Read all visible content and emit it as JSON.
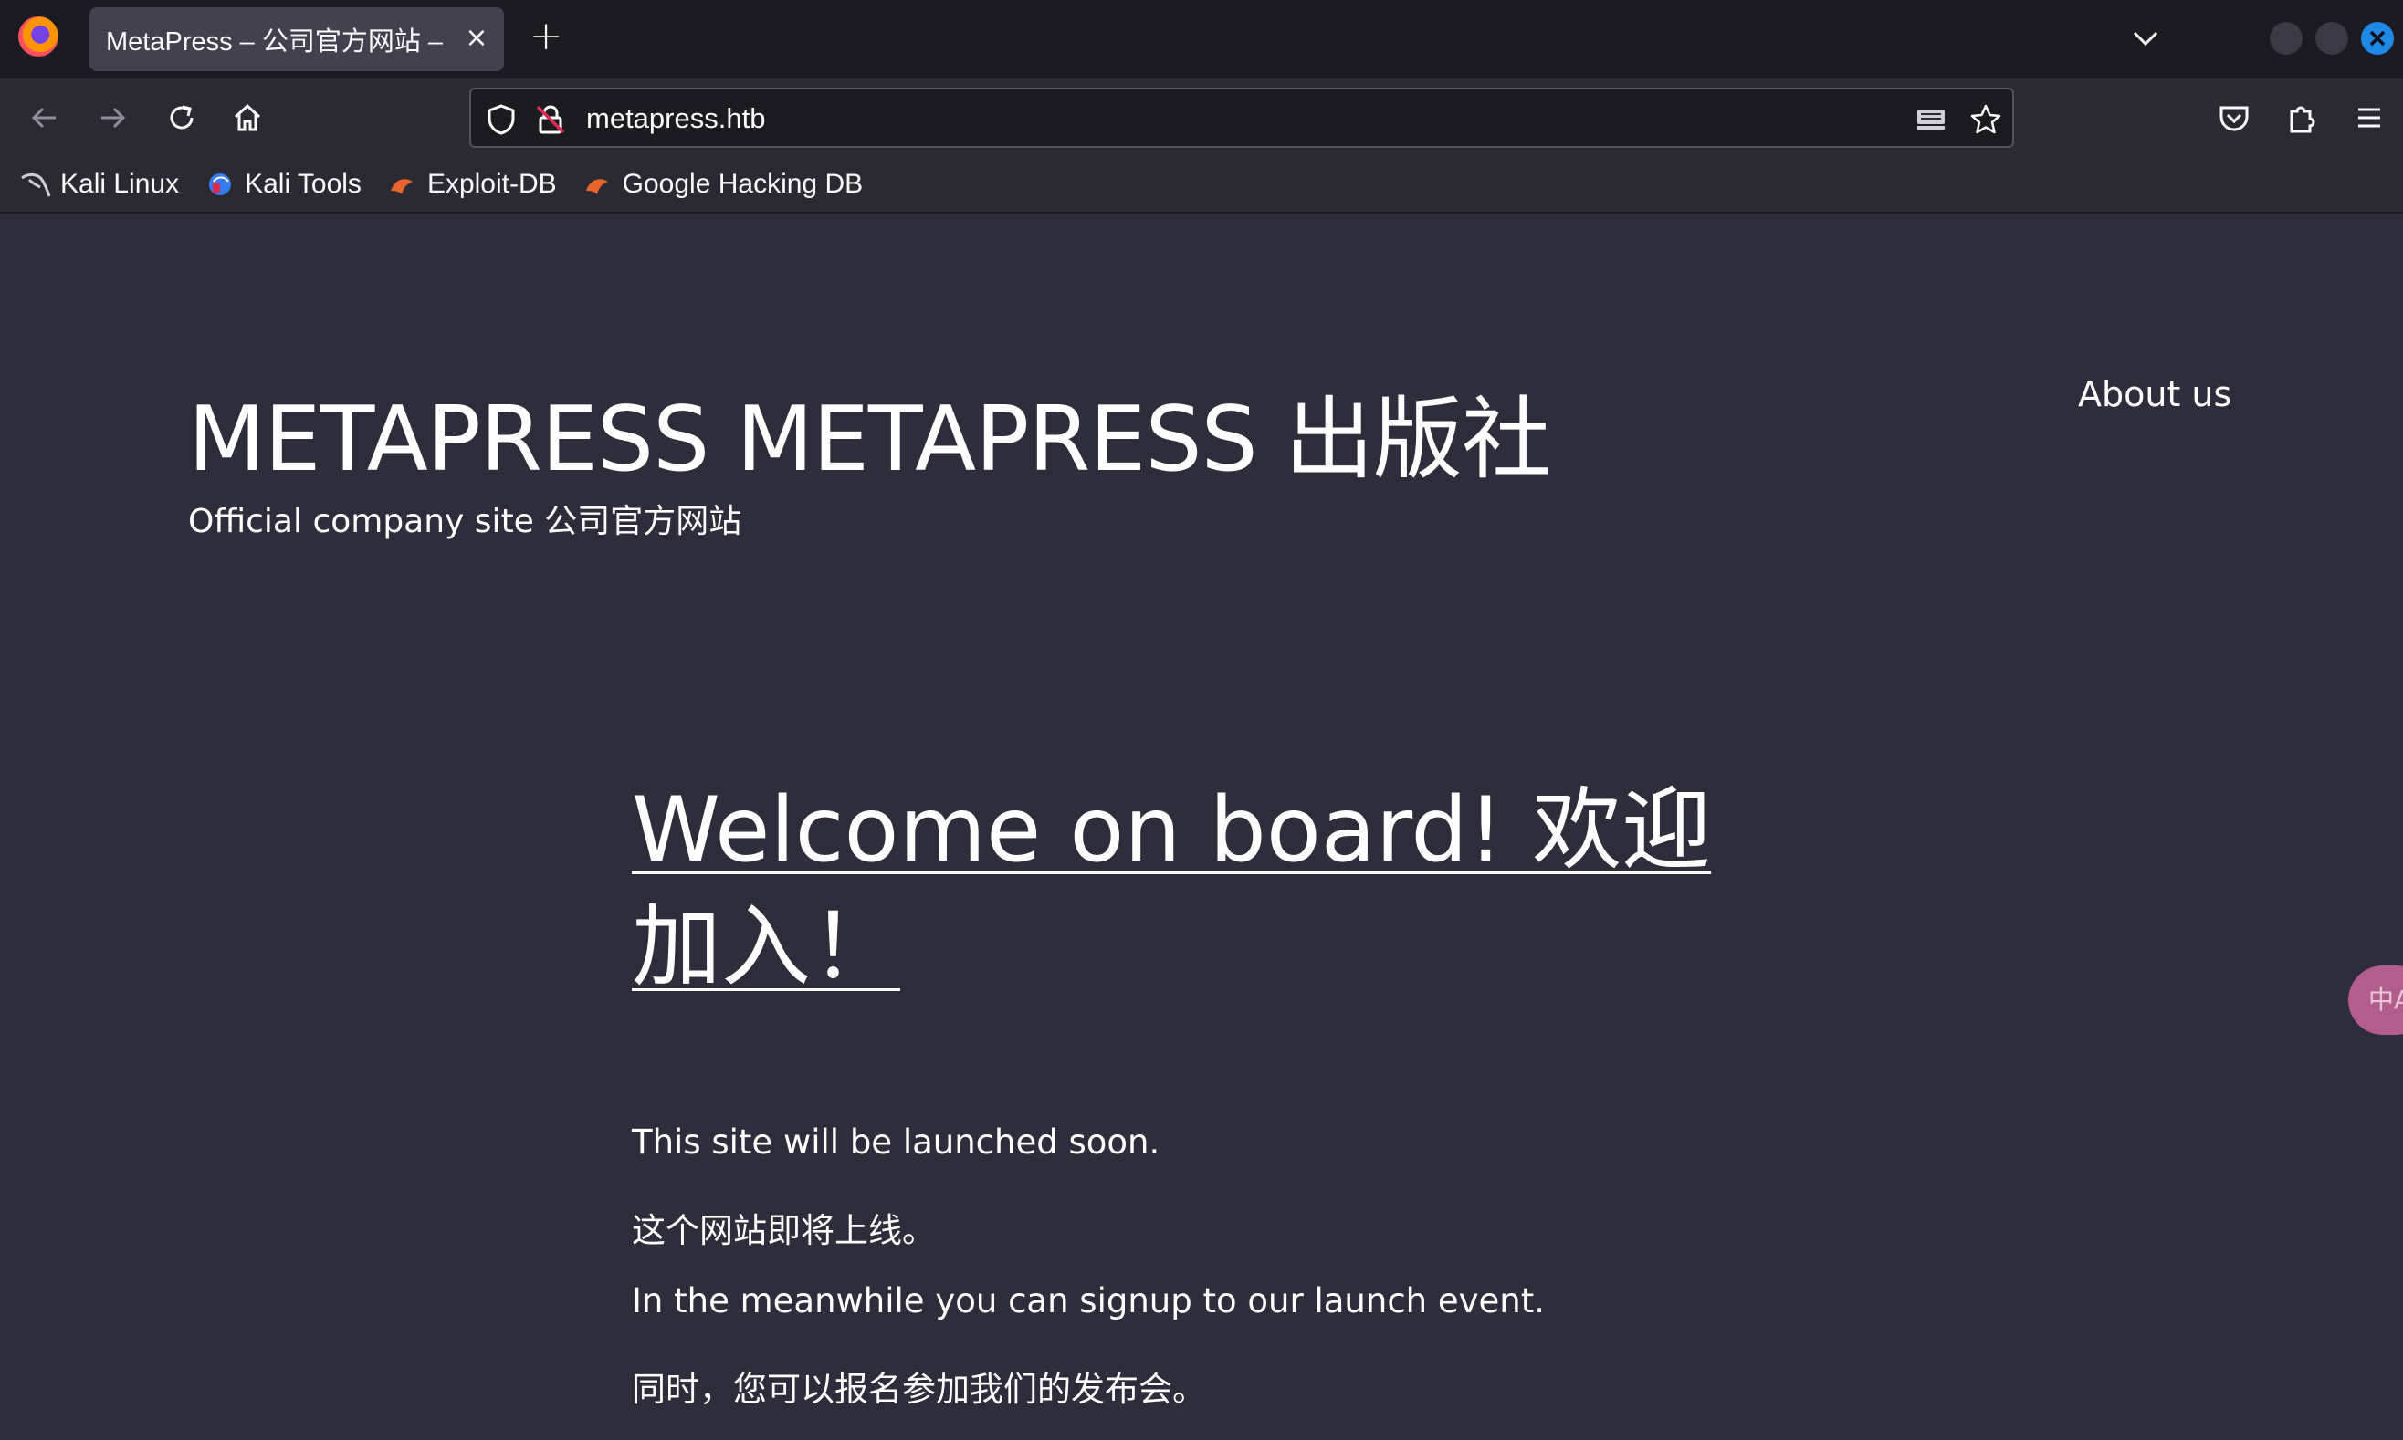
{
  "browser": {
    "tab": {
      "title": "MetaPress – 公司官方网站 – ",
      "close_label": "×"
    },
    "new_tab_label": "+",
    "url": "metapress.htb",
    "bookmarks": [
      {
        "label": "Kali Linux",
        "icon": "kali-dragon-icon"
      },
      {
        "label": "Kali Tools",
        "icon": "kali-tools-icon"
      },
      {
        "label": "Exploit-DB",
        "icon": "exploit-db-icon"
      },
      {
        "label": "Google Hacking DB",
        "icon": "exploit-db-icon"
      }
    ],
    "accent_color": "#1e88e5"
  },
  "site": {
    "title": "METAPRESS METAPRESS 出版社",
    "tagline": "Official company site  公司官方网站",
    "nav": {
      "about": "About us"
    }
  },
  "main": {
    "heading": "Welcome on board! 欢迎加入！",
    "paragraphs": [
      "This site will be launched soon.",
      "这个网站即将上线。",
      "In the meanwhile you can signup to our launch event.",
      "同时，您可以报名参加我们的发布会。"
    ]
  },
  "translate_widget": {
    "icon": "translate-icon",
    "glyph": "中A"
  }
}
